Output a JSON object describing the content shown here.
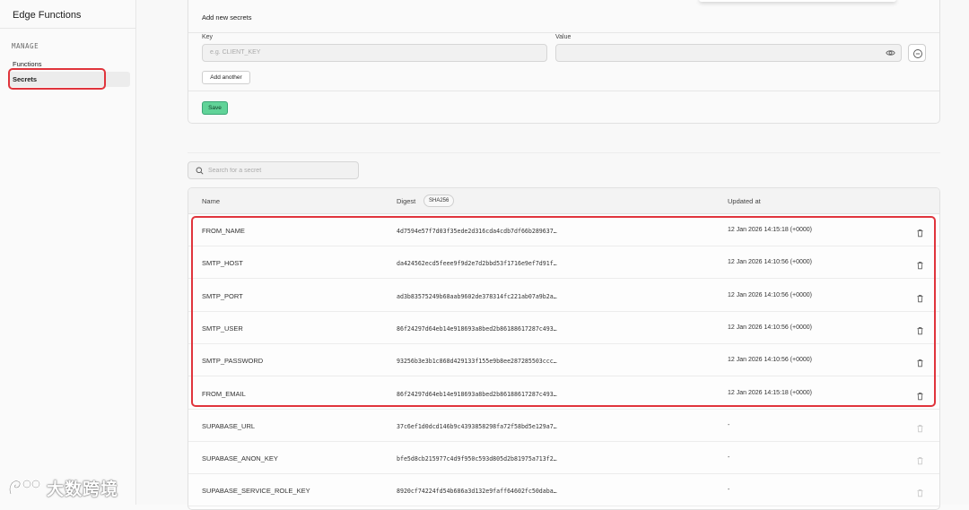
{
  "sidebar": {
    "title": "Edge Functions",
    "section": "MANAGE",
    "items": [
      {
        "label": "Functions"
      },
      {
        "label": "Secrets"
      }
    ]
  },
  "new_secrets": {
    "title": "Add new secrets",
    "key_label": "Key",
    "key_placeholder": "e.g. CLIENT_KEY",
    "value_label": "Value",
    "add_another": "Add another",
    "save": "Save"
  },
  "search": {
    "placeholder": "Search for a secret"
  },
  "table": {
    "headers": {
      "name": "Name",
      "digest": "Digest",
      "digest_badge": "SHA256",
      "updated": "Updated at"
    },
    "rows": [
      {
        "name": "FROM_NAME",
        "digest": "4d7594e57f7d03f35ede2d316cda4cdb7df66b289637…",
        "updated": "12 Jan 2026 14:15:18 (+0000)"
      },
      {
        "name": "SMTP_HOST",
        "digest": "da424562ecd5feee9f9d2e7d2bbd53f1716e9ef7d91f…",
        "updated": "12 Jan 2026 14:10:56 (+0000)"
      },
      {
        "name": "SMTP_PORT",
        "digest": "ad3b83575249b68aab9602de378314fc221ab07a9b2a…",
        "updated": "12 Jan 2026 14:10:56 (+0000)"
      },
      {
        "name": "SMTP_USER",
        "digest": "86f24297d64eb14e918693a8bed2b86188617287c493…",
        "updated": "12 Jan 2026 14:10:56 (+0000)"
      },
      {
        "name": "SMTP_PASSWORD",
        "digest": "93256b3e3b1c868d429133f155e9b8ee287285503ccc…",
        "updated": "12 Jan 2026 14:10:56 (+0000)"
      },
      {
        "name": "FROM_EMAIL",
        "digest": "86f24297d64eb14e918693a8bed2b86188617287c493…",
        "updated": "12 Jan 2026 14:15:18 (+0000)"
      },
      {
        "name": "SUPABASE_URL",
        "digest": "37c6ef1d0dcd146b9c4393858298fa72f58bd5e129a7…",
        "updated": "-"
      },
      {
        "name": "SUPABASE_ANON_KEY",
        "digest": "bfe5d8cb215977c4d9f950c593d805d2b81975a713f2…",
        "updated": "-"
      },
      {
        "name": "SUPABASE_SERVICE_ROLE_KEY",
        "digest": "8920cf74224fd54b686a3d132e9faff64602fc50daba…",
        "updated": "-"
      }
    ]
  },
  "watermark": {
    "text": "大数跨境"
  },
  "colors": {
    "highlight": "#e0343c",
    "save_green": "#60d398"
  }
}
